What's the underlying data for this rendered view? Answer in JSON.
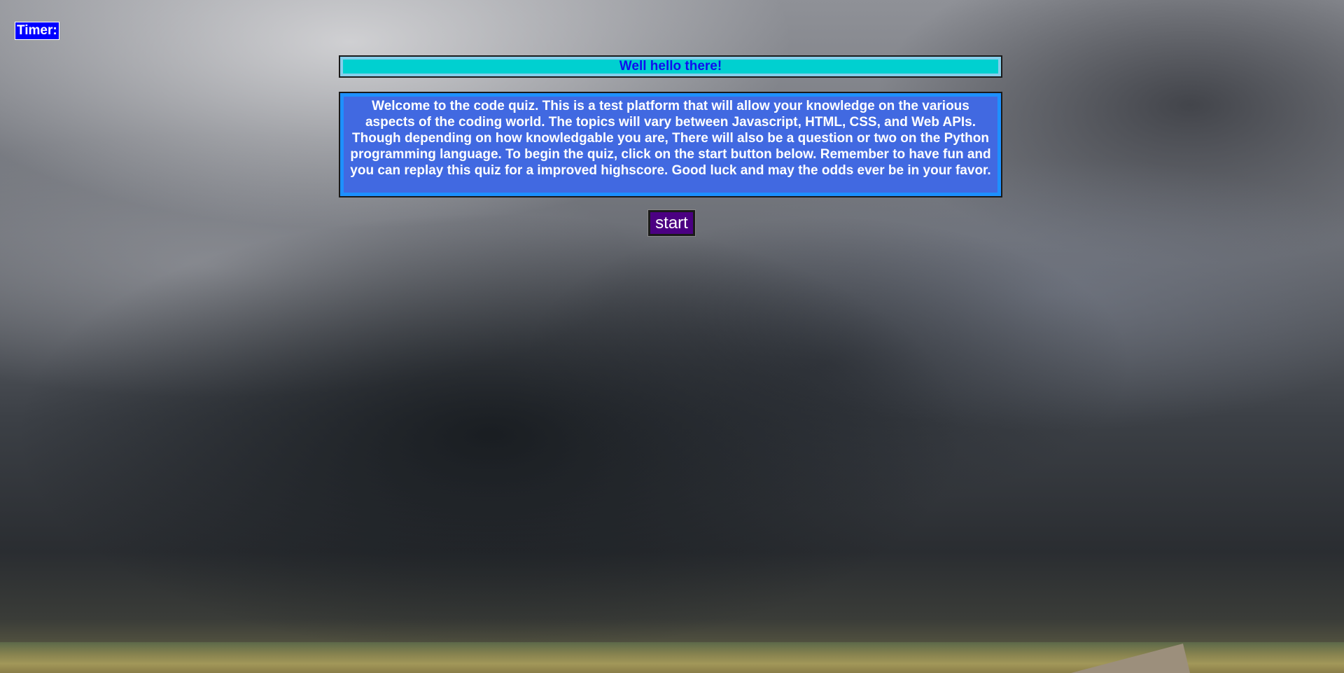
{
  "timer": {
    "label": "Timer:"
  },
  "header": {
    "title": "Well hello there!"
  },
  "intro": {
    "text": "Welcome to the code quiz. This is a test platform that will allow your knowledge on the various aspects of the coding world. The topics will vary between Javascript, HTML, CSS, and Web APIs. Though depending on how knowledgable you are, There will also be a question or two on the Python programming language. To begin the quiz, click on the start button below. Remember to have fun and you can replay this quiz for a improved highscore. Good luck and may the odds ever be in your favor."
  },
  "actions": {
    "start_label": "start"
  },
  "colors": {
    "timer_bg": "#0000ff",
    "header_bg": "#00d0d0",
    "header_text": "#1010ee",
    "intro_bg": "#4169e1",
    "intro_border": "#1e90ff",
    "start_bg": "#4b0082"
  }
}
